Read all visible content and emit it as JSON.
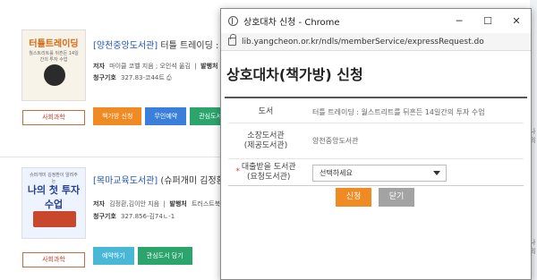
{
  "results": {
    "book1": {
      "library": "[양천중앙도서관]",
      "title": "터틀 트레이딩 : 월스",
      "cover_title": "터틀트레이딩",
      "cover_subtitle": "월스트리트를 뒤흔든 14일간의 투자 수업",
      "author_label": "저자",
      "author": "마이클 코벨 지음 ; 오인석 옮김",
      "publisher_label": "발행처",
      "call_label": "청구기호",
      "call_number": "327.83-코44트",
      "subject_button": "사회과학",
      "actions": [
        "책가방 신청",
        "무인예약",
        "관심도서담기"
      ]
    },
    "book2": {
      "library": "[목마교육도서관]",
      "title": "(슈퍼개미 김정환",
      "cover_title": "나의 첫 투자 수업",
      "cover_subtitle": "슈퍼개미 김정환이 알려주는",
      "author_label": "저자",
      "author": "김정환,김이안 지음",
      "publisher_label": "발행처",
      "publisher": "트러스트북",
      "call_label": "청구기호",
      "call_number": "327.856-김74ㄴ-1",
      "subject_button": "사회과학",
      "actions": [
        "예약하기",
        "관심도서 담기"
      ]
    },
    "right_edge": [
      "나의",
      "나의"
    ]
  },
  "popup": {
    "window_title": "상호대차 신청 - Chrome",
    "url": "lib.yangcheon.or.kr/ndls/memberService/expressRequest.do",
    "controls": [
      "─",
      "☐",
      "✕"
    ],
    "page_title": "상호대차(책가방) 신청",
    "form": {
      "book_label": "도서",
      "book_value": "터틀 트레이딩 : 월스트리트를 뒤흔든 14일간의 투자 수업",
      "holding_label": "소장도서관\n(제공도서관)",
      "holding_value": "양천중앙도서관",
      "required_mark": "*",
      "pickup_label": "대출받을 도서관\n(요청도서관)",
      "pickup_value": "선택하세요"
    },
    "buttons": {
      "apply": "신청",
      "close": "닫기"
    }
  }
}
